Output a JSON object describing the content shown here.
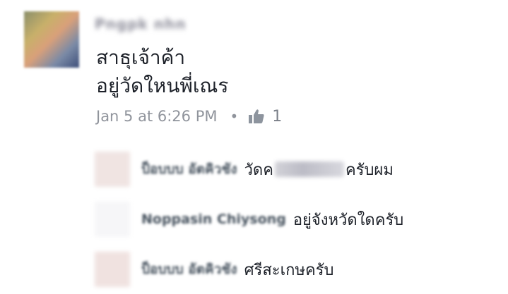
{
  "post": {
    "author_name": "Pngpk nhn",
    "text_line1": "สาธุเจ้าค้า",
    "text_line2": "อยู่วัดใหนพี่เณร",
    "timestamp": "Jan 5 at 6:26 PM",
    "separator": "•",
    "like_count": "1"
  },
  "replies": [
    {
      "name": "ป็อบบบ อัตคิวชัง",
      "text_before": "วัดค",
      "text_after": "ครับผม",
      "redacted": true
    },
    {
      "name": "Noppasin Chiysong",
      "text": "อยู่จังหวัดใดครับ"
    },
    {
      "name": "ป็อบบบ อัตคิวชัง",
      "text": "ศรีสะเกษครับ"
    }
  ],
  "colors": {
    "text": "#1d2129",
    "meta": "#90949c",
    "name": "#46525e",
    "like_icon": "#8d949e"
  }
}
